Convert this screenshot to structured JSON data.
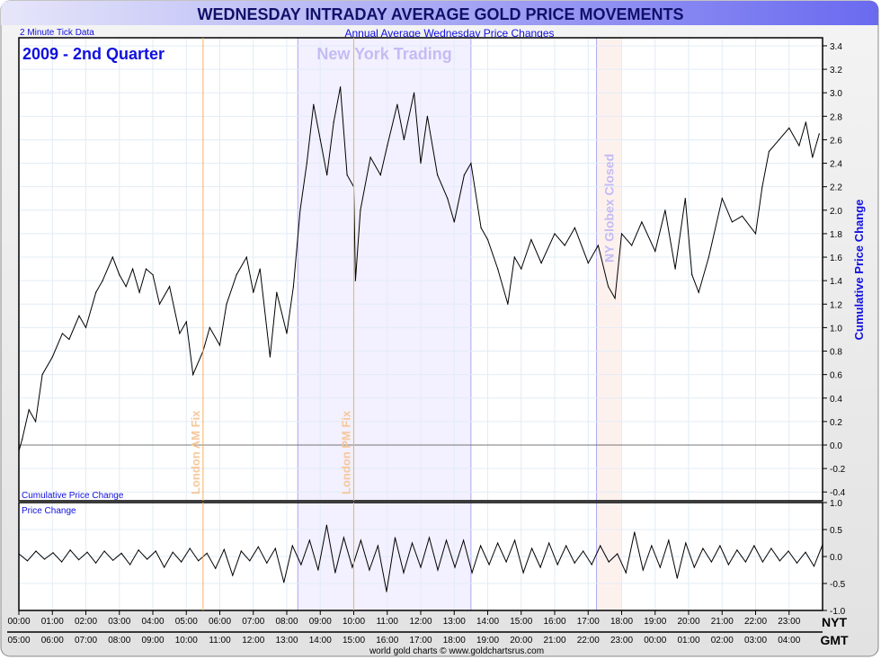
{
  "header": {
    "title": "WEDNESDAY INTRADAY AVERAGE GOLD PRICE MOVEMENTS",
    "subtitle": "Annual Average Wednesday Price Changes",
    "tick_note": "2 Minute Tick Data",
    "period": "2009 - 2nd Quarter",
    "footer": "world gold charts © www.goldchartsrus.com"
  },
  "colors": {
    "title_bar": "#7070f0",
    "title_text": "#10106a",
    "label_blue": "#1010e0",
    "fix_line": "#f4b060",
    "ny_shade": "#f3f0ff",
    "globex_shade": "#fdf1ee"
  },
  "chart_data": [
    {
      "type": "line",
      "name": "cumulative",
      "panel_label": "Cumulative Price Change",
      "ylabel": "Cumulative Price Change",
      "ylim": [
        -0.45,
        3.5
      ],
      "yticks": [
        "3.4",
        "3.2",
        "3.0",
        "2.8",
        "2.6",
        "2.4",
        "2.2",
        "2.0",
        "1.8",
        "1.6",
        "1.4",
        "1.2",
        "1.0",
        "0.8",
        "0.6",
        "0.4",
        "0.2",
        "0.0",
        "-0.2",
        "-0.4"
      ],
      "x_hours": [
        0,
        0.1,
        0.3,
        0.5,
        0.7,
        1.0,
        1.3,
        1.5,
        1.8,
        2.0,
        2.3,
        2.5,
        2.8,
        3.0,
        3.2,
        3.4,
        3.6,
        3.8,
        4.0,
        4.2,
        4.5,
        4.8,
        5.0,
        5.2,
        5.5,
        5.7,
        6.0,
        6.2,
        6.5,
        6.8,
        7.0,
        7.2,
        7.5,
        7.7,
        8.0,
        8.2,
        8.4,
        8.6,
        8.8,
        9.0,
        9.2,
        9.4,
        9.6,
        9.8,
        10.0,
        10.05,
        10.2,
        10.5,
        10.8,
        11.0,
        11.3,
        11.5,
        11.8,
        12.0,
        12.2,
        12.5,
        12.8,
        13.0,
        13.3,
        13.5,
        13.8,
        14.0,
        14.3,
        14.6,
        14.8,
        15.0,
        15.3,
        15.6,
        16.0,
        16.3,
        16.6,
        17.0,
        17.3,
        17.6,
        17.8,
        18.0,
        18.3,
        18.6,
        19.0,
        19.3,
        19.6,
        19.9,
        20.1,
        20.3,
        20.6,
        21.0,
        21.3,
        21.6,
        22.0,
        22.2,
        22.4,
        22.7,
        23.0,
        23.3,
        23.5,
        23.7,
        23.9
      ],
      "values": [
        -0.05,
        0.05,
        0.3,
        0.2,
        0.6,
        0.75,
        0.95,
        0.9,
        1.1,
        1.0,
        1.3,
        1.4,
        1.6,
        1.45,
        1.35,
        1.5,
        1.3,
        1.5,
        1.45,
        1.2,
        1.35,
        0.95,
        1.05,
        0.6,
        0.8,
        1.0,
        0.85,
        1.2,
        1.45,
        1.6,
        1.3,
        1.5,
        0.75,
        1.3,
        0.95,
        1.35,
        2.0,
        2.4,
        2.9,
        2.6,
        2.3,
        2.75,
        3.05,
        2.3,
        2.2,
        1.4,
        2.0,
        2.45,
        2.3,
        2.55,
        2.9,
        2.6,
        3.0,
        2.4,
        2.8,
        2.3,
        2.1,
        1.9,
        2.3,
        2.4,
        1.85,
        1.75,
        1.5,
        1.2,
        1.6,
        1.5,
        1.75,
        1.55,
        1.8,
        1.7,
        1.85,
        1.55,
        1.7,
        1.35,
        1.25,
        1.8,
        1.7,
        1.9,
        1.65,
        2.0,
        1.5,
        2.1,
        1.45,
        1.3,
        1.6,
        2.1,
        1.9,
        1.95,
        1.8,
        2.2,
        2.5,
        2.6,
        2.7,
        2.55,
        2.75,
        2.45,
        2.65
      ]
    },
    {
      "type": "line",
      "name": "price_change",
      "panel_label": "Price Change",
      "ylim": [
        -1.0,
        1.0
      ],
      "yticks": [
        "1.0",
        "0.5",
        "0.0",
        "-0.5",
        "-1.0"
      ],
      "values": [
        0.05,
        -0.08,
        0.1,
        -0.05,
        0.07,
        -0.1,
        0.12,
        -0.06,
        0.08,
        -0.12,
        0.1,
        -0.07,
        0.06,
        -0.15,
        0.12,
        -0.05,
        0.1,
        -0.2,
        0.08,
        -0.1,
        0.15,
        -0.08,
        0.06,
        -0.22,
        0.13,
        -0.35,
        0.1,
        -0.08,
        0.18,
        -0.12,
        0.15,
        -0.48,
        0.2,
        -0.15,
        0.3,
        -0.25,
        0.58,
        -0.3,
        0.35,
        -0.2,
        0.3,
        -0.25,
        0.2,
        -0.65,
        0.35,
        -0.3,
        0.25,
        -0.2,
        0.35,
        -0.25,
        0.3,
        -0.2,
        0.3,
        -0.3,
        0.2,
        -0.15,
        0.25,
        -0.1,
        0.3,
        -0.3,
        0.15,
        -0.2,
        0.25,
        -0.15,
        0.2,
        -0.12,
        0.1,
        -0.15,
        0.2,
        -0.1,
        0.05,
        -0.3,
        0.45,
        -0.25,
        0.2,
        -0.2,
        0.3,
        -0.4,
        0.25,
        -0.2,
        0.15,
        -0.1,
        0.2,
        -0.15,
        0.12,
        -0.1,
        0.2,
        -0.1,
        0.15,
        -0.08,
        0.1,
        -0.12,
        0.08,
        -0.18,
        0.22
      ]
    }
  ],
  "x_axis": {
    "nyt_label": "NYT",
    "gmt_label": "GMT",
    "nyt_ticks": [
      "00:00",
      "01:00",
      "02:00",
      "03:00",
      "04:00",
      "05:00",
      "06:00",
      "07:00",
      "08:00",
      "09:00",
      "10:00",
      "11:00",
      "12:00",
      "13:00",
      "14:00",
      "15:00",
      "16:00",
      "17:00",
      "18:00",
      "19:00",
      "20:00",
      "21:00",
      "22:00",
      "23:00"
    ],
    "gmt_ticks": [
      "05:00",
      "06:00",
      "07:00",
      "08:00",
      "09:00",
      "10:00",
      "11:00",
      "12:00",
      "13:00",
      "14:00",
      "15:00",
      "16:00",
      "17:00",
      "18:00",
      "19:00",
      "20:00",
      "21:00",
      "22:00",
      "23:00",
      "00:00",
      "01:00",
      "02:00",
      "03:00",
      "04:00"
    ]
  },
  "annotations": {
    "london_am": {
      "label": "London AM Fix",
      "hour": 5.5
    },
    "london_pm": {
      "label": "London PM Fix",
      "hour": 10.0
    },
    "ny_trading": {
      "label": "New York Trading",
      "start": 8.33,
      "end": 13.5
    },
    "globex": {
      "label": "NY Globex Closed",
      "start": 17.25,
      "end": 18.0
    }
  }
}
